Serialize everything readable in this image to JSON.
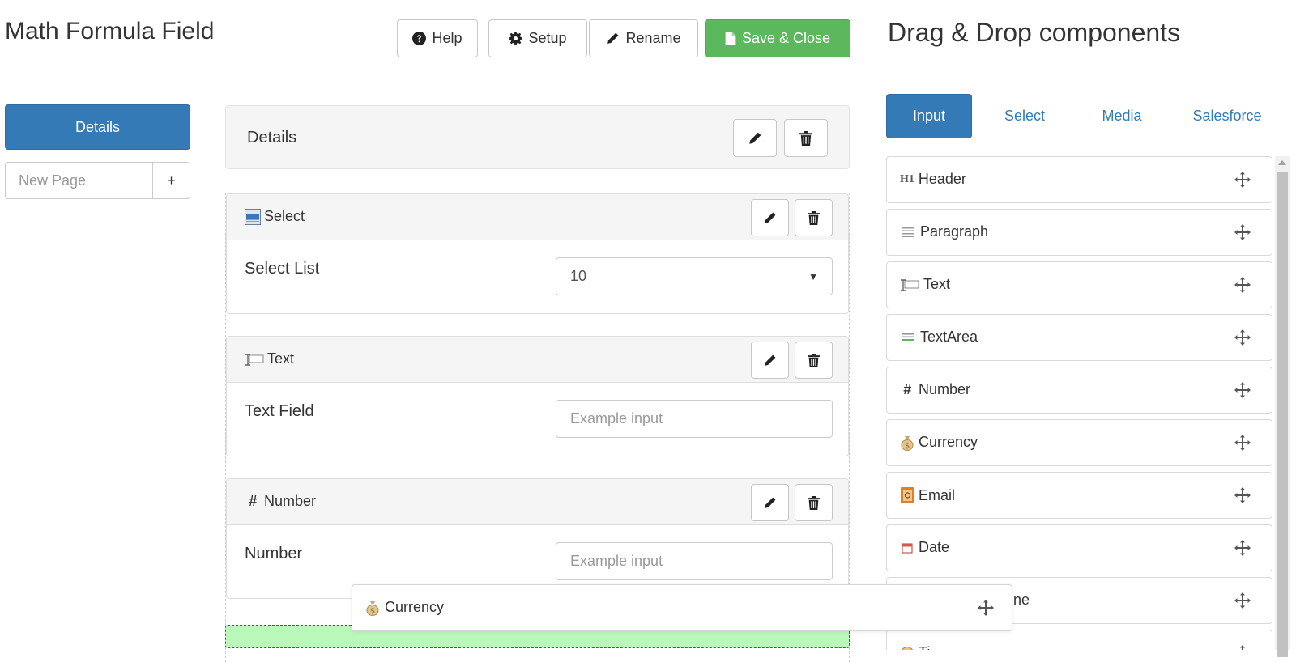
{
  "header": {
    "title": "Math Formula Field",
    "buttons": {
      "help": "Help",
      "setup": "Setup",
      "rename": "Rename",
      "save_close": "Save & Close"
    }
  },
  "pages": {
    "active": "Details",
    "new_page_placeholder": "New Page",
    "add_label": "+"
  },
  "builder": {
    "page_header": "Details",
    "fields": [
      {
        "type_label": "Select",
        "label": "Select List",
        "value": "10"
      },
      {
        "type_label": "Text",
        "label": "Text Field",
        "placeholder": "Example input"
      },
      {
        "type_label": "Number",
        "label": "Number",
        "placeholder": "Example input",
        "icon_glyph": "#"
      }
    ],
    "dragging": {
      "label": "Currency",
      "hidden_text": "ne"
    }
  },
  "components": {
    "title": "Drag & Drop components",
    "tabs": [
      "Input",
      "Select",
      "Media",
      "Salesforce"
    ],
    "active_tab": "Input",
    "items": [
      {
        "label": "Header",
        "icon": "h1-icon",
        "icon_glyph": "H1"
      },
      {
        "label": "Paragraph",
        "icon": "paragraph-icon"
      },
      {
        "label": "Text",
        "icon": "text-field-icon"
      },
      {
        "label": "TextArea",
        "icon": "textarea-icon"
      },
      {
        "label": "Number",
        "icon": "hash-icon",
        "icon_glyph": "#"
      },
      {
        "label": "Currency",
        "icon": "money-bag-icon"
      },
      {
        "label": "Email",
        "icon": "address-book-icon"
      },
      {
        "label": "Date",
        "icon": "calendar-icon"
      },
      {
        "label": "ne",
        "icon": "none"
      },
      {
        "label": "Ti",
        "icon": "clock-icon"
      }
    ]
  },
  "colors": {
    "primary": "#337ab7",
    "success": "#5cb85c",
    "drop_zone": "#b9f8b9",
    "panel_bg": "#f5f5f5"
  }
}
